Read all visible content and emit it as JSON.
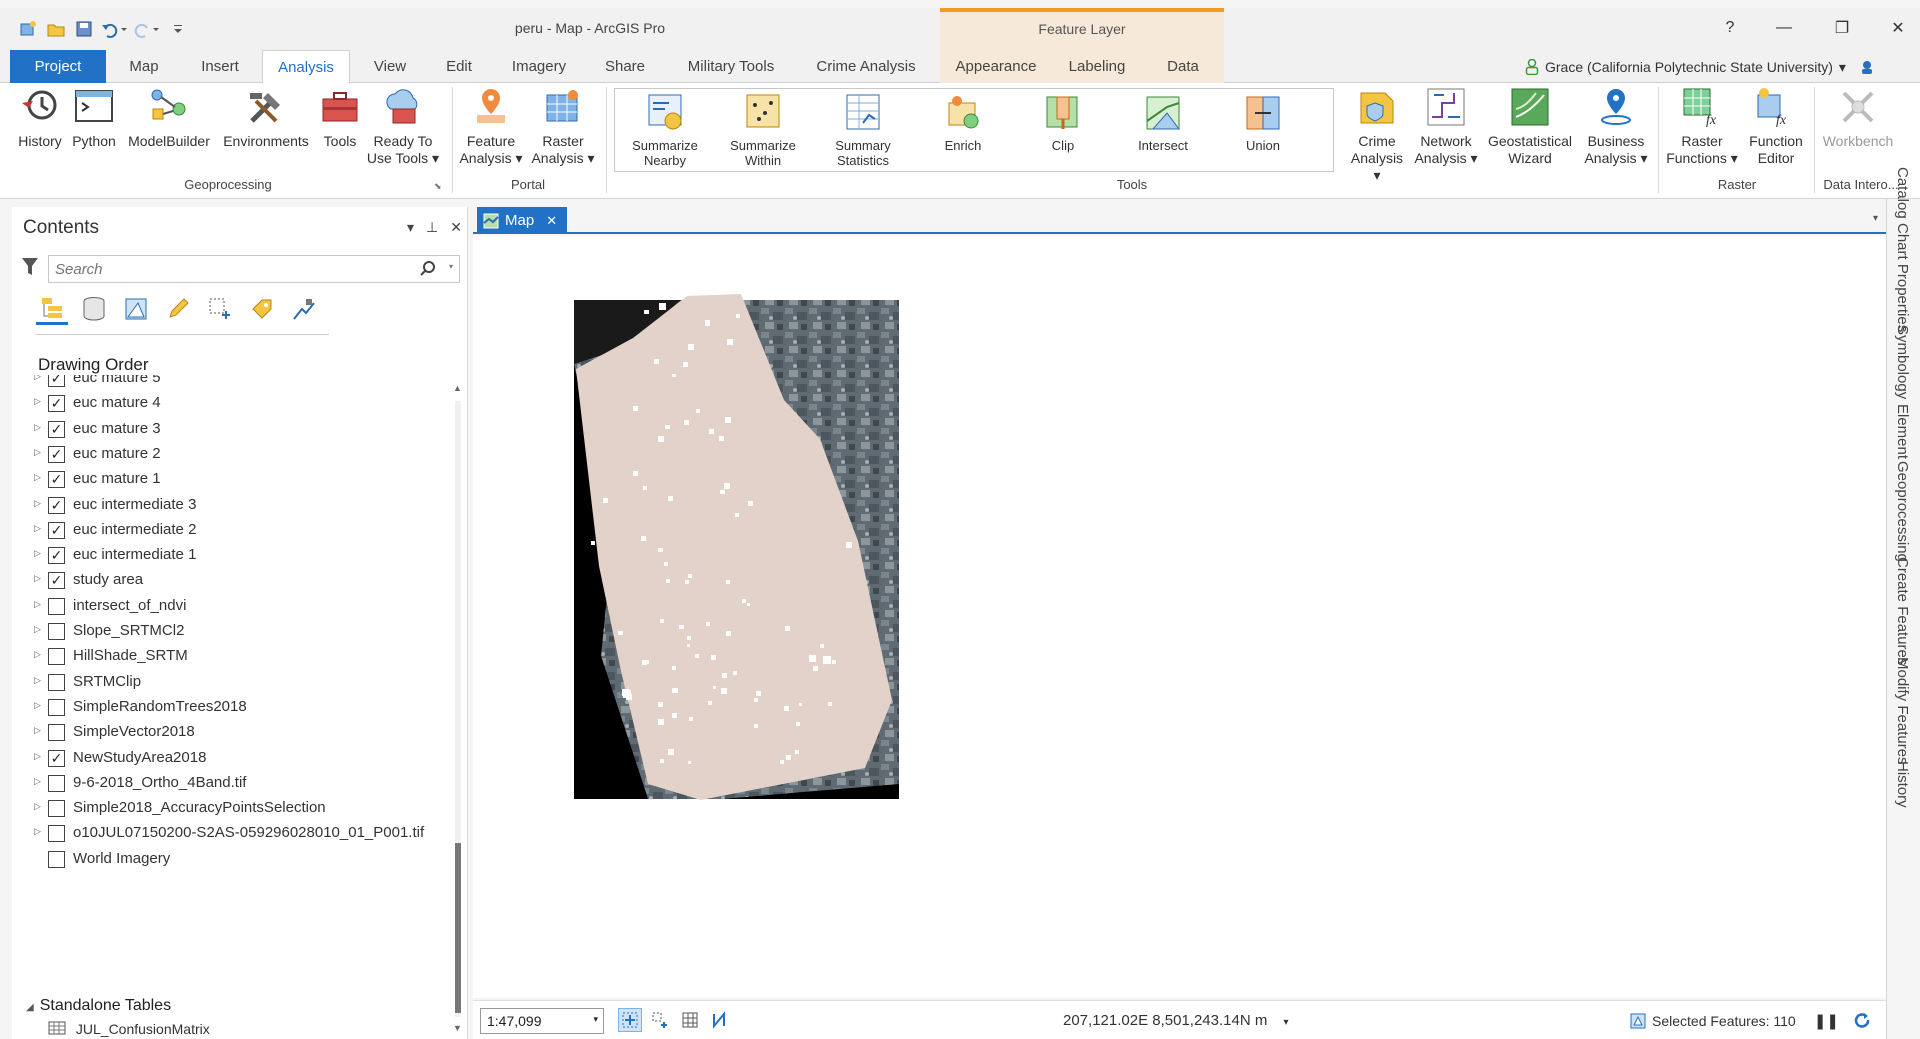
{
  "window": {
    "title": "peru - Map - ArcGIS Pro",
    "context_tab_group": "Feature Layer",
    "help_label": "?",
    "minimize_label": "—",
    "restore_label": "❐",
    "close_label": "✕"
  },
  "user": {
    "name": "Grace (California Polytechnic State University)",
    "dropdown": "▾"
  },
  "tabs": [
    {
      "label": "Project"
    },
    {
      "label": "Map"
    },
    {
      "label": "Insert"
    },
    {
      "label": "Analysis"
    },
    {
      "label": "View"
    },
    {
      "label": "Edit"
    },
    {
      "label": "Imagery"
    },
    {
      "label": "Share"
    },
    {
      "label": "Military Tools"
    },
    {
      "label": "Crime Analysis"
    },
    {
      "label": "Appearance"
    },
    {
      "label": "Labeling"
    },
    {
      "label": "Data"
    }
  ],
  "active_tab": "Analysis",
  "ribbon": {
    "geoprocessing": {
      "group_label": "Geoprocessing",
      "buttons": [
        {
          "label": "History",
          "icon": "history-icon"
        },
        {
          "label": "Python",
          "icon": "python-icon"
        },
        {
          "label": "ModelBuilder",
          "icon": "modelbuilder-icon"
        },
        {
          "label": "Environments",
          "icon": "environments-icon"
        },
        {
          "label": "Tools",
          "icon": "toolbox-icon"
        },
        {
          "label": "Ready To\nUse Tools ▾",
          "icon": "ready-to-use-icon"
        }
      ]
    },
    "portal": {
      "group_label": "Portal",
      "buttons": [
        {
          "label": "Feature\nAnalysis ▾",
          "icon": "feature-analysis-icon"
        },
        {
          "label": "Raster\nAnalysis ▾",
          "icon": "raster-analysis-icon"
        }
      ]
    },
    "tools": {
      "group_label": "Tools",
      "buttons": [
        {
          "label": "Summarize\nNearby",
          "icon": "summarize-nearby-icon"
        },
        {
          "label": "Summarize\nWithin",
          "icon": "summarize-within-icon"
        },
        {
          "label": "Summary\nStatistics",
          "icon": "summary-statistics-icon"
        },
        {
          "label": "Enrich",
          "icon": "enrich-icon"
        },
        {
          "label": "Clip",
          "icon": "clip-icon"
        },
        {
          "label": "Intersect",
          "icon": "intersect-icon"
        },
        {
          "label": "Union",
          "icon": "union-icon"
        }
      ],
      "more": [
        {
          "label": "Crime\nAnalysis ▾",
          "icon": "crime-analysis-icon"
        },
        {
          "label": "Network\nAnalysis ▾",
          "icon": "network-analysis-icon"
        },
        {
          "label": "Geostatistical\nWizard",
          "icon": "geostatistical-wizard-icon"
        },
        {
          "label": "Business\nAnalysis ▾",
          "icon": "business-analysis-icon"
        }
      ]
    },
    "raster": {
      "group_label": "Raster",
      "buttons": [
        {
          "label": "Raster\nFunctions ▾",
          "icon": "raster-functions-icon"
        },
        {
          "label": "Function\nEditor",
          "icon": "function-editor-icon"
        }
      ]
    },
    "data_interop": {
      "group_label": "Data Intero...",
      "buttons": [
        {
          "label": "Workbench",
          "icon": "workbench-icon"
        }
      ]
    }
  },
  "contents": {
    "title": "Contents",
    "search_placeholder": "Search",
    "section_title": "Drawing Order",
    "layers": [
      {
        "name": "euc mature 5",
        "checked": true,
        "expandable": true
      },
      {
        "name": "euc mature 4",
        "checked": true,
        "expandable": true
      },
      {
        "name": "euc mature 3",
        "checked": true,
        "expandable": true
      },
      {
        "name": "euc mature 2",
        "checked": true,
        "expandable": true
      },
      {
        "name": "euc mature 1",
        "checked": true,
        "expandable": true
      },
      {
        "name": "euc intermediate 3",
        "checked": true,
        "expandable": true
      },
      {
        "name": "euc intermediate 2",
        "checked": true,
        "expandable": true
      },
      {
        "name": "euc intermediate 1",
        "checked": true,
        "expandable": true
      },
      {
        "name": "study area",
        "checked": true,
        "expandable": true
      },
      {
        "name": "intersect_of_ndvi",
        "checked": false,
        "expandable": true
      },
      {
        "name": "Slope_SRTMCl2",
        "checked": false,
        "expandable": true
      },
      {
        "name": "HillShade_SRTM",
        "checked": false,
        "expandable": true
      },
      {
        "name": "SRTMClip",
        "checked": false,
        "expandable": true
      },
      {
        "name": "SimpleRandomTrees2018",
        "checked": false,
        "expandable": true
      },
      {
        "name": "SimpleVector2018",
        "checked": false,
        "expandable": true
      },
      {
        "name": "NewStudyArea2018",
        "checked": true,
        "expandable": true
      },
      {
        "name": "9-6-2018_Ortho_4Band.tif",
        "checked": false,
        "expandable": true
      },
      {
        "name": "Simple2018_AccuracyPointsSelection",
        "checked": false,
        "expandable": true
      },
      {
        "name": "o10JUL07150200-S2AS-059296028010_01_P001.tif",
        "checked": false,
        "expandable": true
      },
      {
        "name": "World Imagery",
        "checked": false,
        "expandable": false
      }
    ],
    "standalone_title": "Standalone Tables",
    "standalone_item": "JUL_ConfusionMatrix"
  },
  "map": {
    "tab_label": "Map",
    "scale": "1:47,099",
    "coordinates": "207,121.02E 8,501,243.14N m",
    "selected_features": "Selected Features: 110"
  },
  "right_dock": [
    "Catalog",
    "Chart Properties",
    "Symbology",
    "Element",
    "Geoprocessing",
    "Create Features",
    "Modify Features",
    "History"
  ],
  "colors": {
    "accent": "#2171c7",
    "context_tab": "#f7e9d9",
    "context_tab_border": "#f59a23",
    "study_area_fill": "#e3d2c9"
  }
}
